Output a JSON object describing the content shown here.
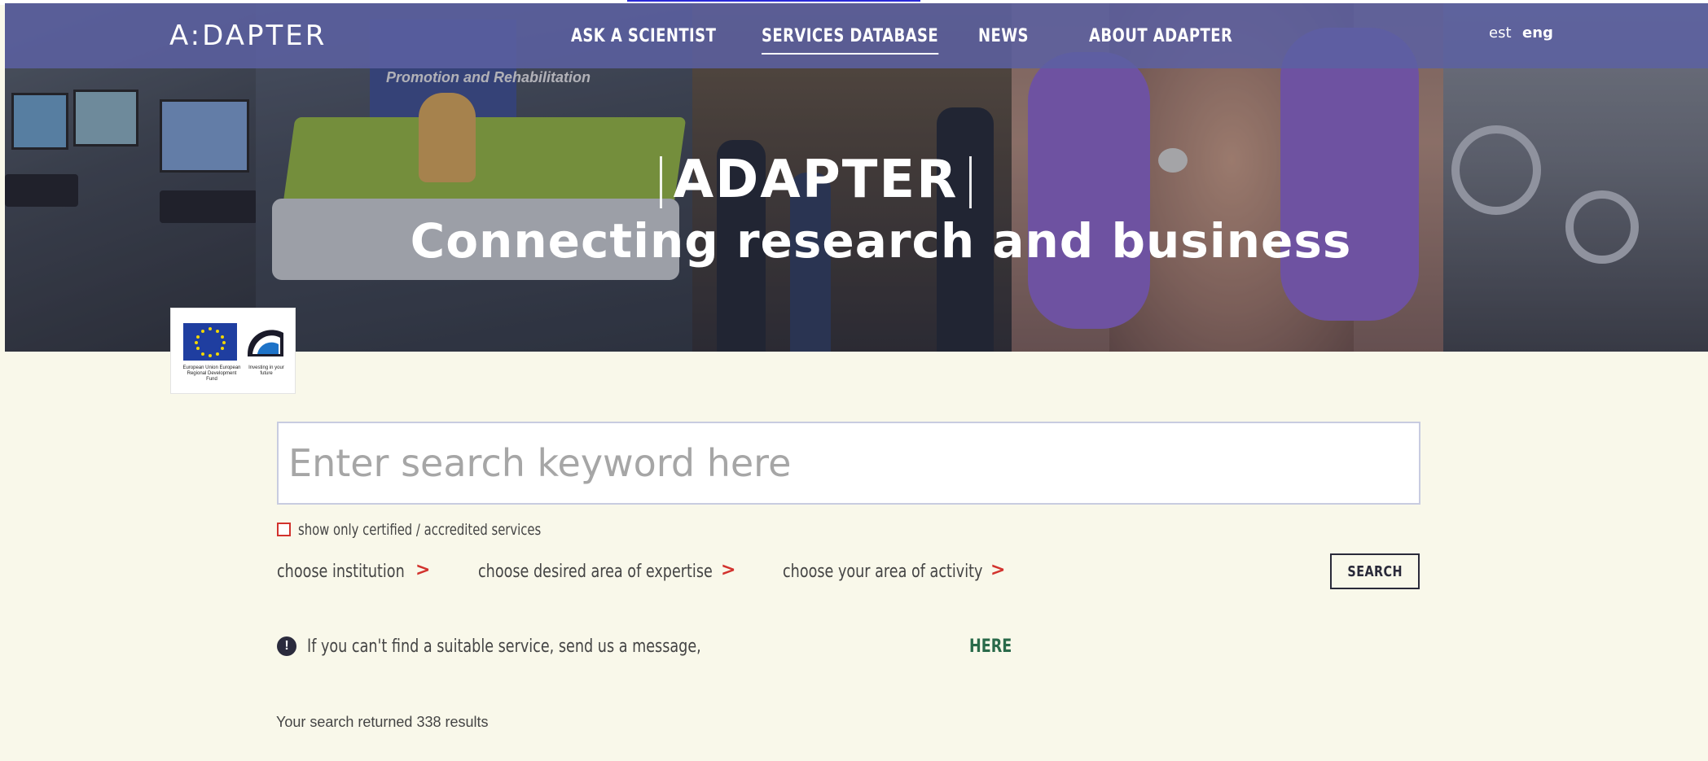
{
  "nav": {
    "logo": "A:DAPTER",
    "items": [
      {
        "label": "ASK A SCIENTIST"
      },
      {
        "label": "SERVICES DATABASE",
        "active": true
      },
      {
        "label": "NEWS"
      },
      {
        "label": "ABOUT ADAPTER"
      }
    ],
    "languages": [
      {
        "label": "est"
      },
      {
        "label": "eng",
        "active": true
      }
    ],
    "color": "#5c60a2"
  },
  "hero": {
    "title": "ADAPTER",
    "subtitle": "Connecting research and business",
    "banner_text": "Promotion and Rehabilitation"
  },
  "sponsor": {
    "eu_caption": "European Union European Regional Development Fund",
    "ee_caption": "Investing in your future"
  },
  "search": {
    "placeholder": "Enter search keyword here",
    "value": "",
    "certified_label": "show only certified / accredited services",
    "certified_checked": false,
    "filters": [
      {
        "label": "choose institution"
      },
      {
        "label": "choose desired area of expertise"
      },
      {
        "label": "choose your area of activity"
      }
    ],
    "chevron": ">",
    "button_label": "SEARCH"
  },
  "info": {
    "icon": "!",
    "text": "If you can't find a suitable service, send us a message,",
    "link_label": "HERE"
  },
  "results": {
    "text": "Your search returned 338 results",
    "count": 338
  },
  "colors": {
    "background": "#f9f8ea",
    "accent_red": "#d2322d",
    "link_green": "#2a6a4a",
    "dark": "#2a2a3a"
  }
}
